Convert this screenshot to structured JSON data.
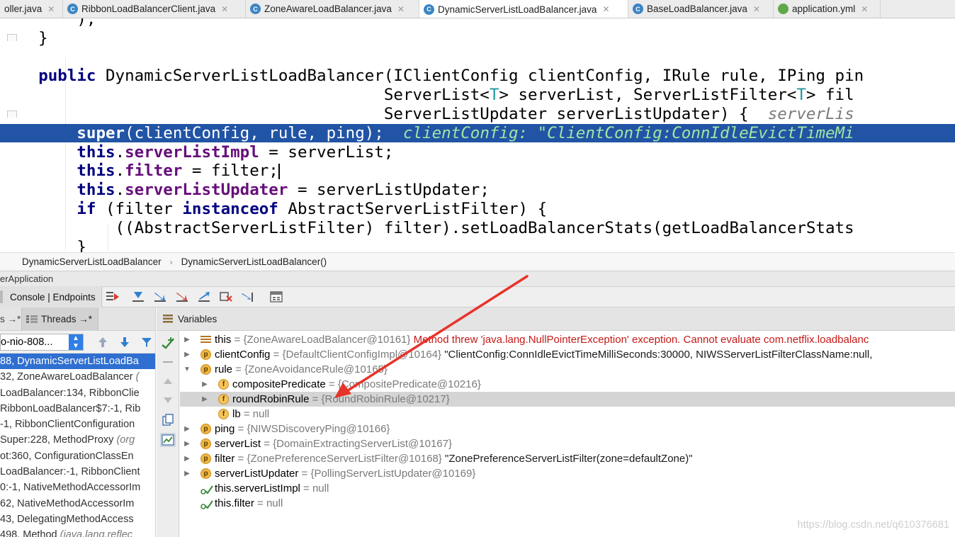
{
  "tabs": [
    {
      "label": "oller.java",
      "active": false,
      "icon": "",
      "close": "✕"
    },
    {
      "label": "RibbonLoadBalancerClient.java",
      "active": false,
      "icon": "java-class-icon",
      "close": "✕"
    },
    {
      "label": "ZoneAwareLoadBalancer.java",
      "active": false,
      "icon": "java-class-icon",
      "close": "✕"
    },
    {
      "label": "DynamicServerListLoadBalancer.java",
      "active": true,
      "icon": "java-class-icon",
      "close": "✕"
    },
    {
      "label": "BaseLoadBalancer.java",
      "active": false,
      "icon": "java-class-icon",
      "close": "✕"
    },
    {
      "label": "application.yml",
      "active": false,
      "icon": "yml-icon",
      "close": "✕"
    }
  ],
  "editor": {
    "lines": [
      {
        "segments": [
          {
            "t": "        );",
            "c": ""
          }
        ]
      },
      {
        "segments": [
          {
            "t": "    }",
            "c": ""
          }
        ]
      },
      {
        "segments": [
          {
            "t": "",
            "c": ""
          }
        ]
      },
      {
        "segments": [
          {
            "t": "    ",
            "c": ""
          },
          {
            "t": "public",
            "c": "kw"
          },
          {
            "t": " DynamicServerListLoadBalancer(IClientConfig clientConfig, IRule rule, IPing pin",
            "c": ""
          }
        ]
      },
      {
        "segments": [
          {
            "t": "                                        ServerList<",
            "c": ""
          },
          {
            "t": "T",
            "c": "gen"
          },
          {
            "t": "> serverList, ServerListFilter<",
            "c": ""
          },
          {
            "t": "T",
            "c": "gen"
          },
          {
            "t": "> fil",
            "c": ""
          }
        ]
      },
      {
        "segments": [
          {
            "t": "                                        ServerListUpdater serverListUpdater) {  ",
            "c": ""
          },
          {
            "t": "serverLis",
            "c": "hint"
          }
        ]
      },
      {
        "segments": [
          {
            "t": "        ",
            "c": ""
          },
          {
            "t": "super",
            "c": "kw"
          },
          {
            "t": "(clientConfig, rule, ping);  ",
            "c": ""
          },
          {
            "t": "clientConfig: \"ClientConfig:ConnIdleEvictTimeMi",
            "c": "hint-exec"
          }
        ],
        "exec": true
      },
      {
        "segments": [
          {
            "t": "        ",
            "c": ""
          },
          {
            "t": "this",
            "c": "kw"
          },
          {
            "t": ".",
            "c": ""
          },
          {
            "t": "serverListImpl",
            "c": "fld"
          },
          {
            "t": " = serverList;",
            "c": ""
          }
        ]
      },
      {
        "segments": [
          {
            "t": "        ",
            "c": ""
          },
          {
            "t": "this",
            "c": "kw"
          },
          {
            "t": ".",
            "c": ""
          },
          {
            "t": "filter",
            "c": "fld"
          },
          {
            "t": " = filter;",
            "c": ""
          }
        ],
        "caret": true
      },
      {
        "segments": [
          {
            "t": "        ",
            "c": ""
          },
          {
            "t": "this",
            "c": "kw"
          },
          {
            "t": ".",
            "c": ""
          },
          {
            "t": "serverListUpdater",
            "c": "fld"
          },
          {
            "t": " = serverListUpdater;",
            "c": ""
          }
        ]
      },
      {
        "segments": [
          {
            "t": "        ",
            "c": ""
          },
          {
            "t": "if",
            "c": "kw"
          },
          {
            "t": " (filter ",
            "c": ""
          },
          {
            "t": "instanceof",
            "c": "kw"
          },
          {
            "t": " AbstractServerListFilter) {",
            "c": ""
          }
        ]
      },
      {
        "segments": [
          {
            "t": "            ((AbstractServerListFilter) filter).setLoadBalancerStats(getLoadBalancerStats",
            "c": ""
          }
        ]
      },
      {
        "segments": [
          {
            "t": "        }",
            "c": ""
          }
        ]
      }
    ]
  },
  "breadcrumb": {
    "items": [
      "DynamicServerListLoadBalancer",
      "DynamicServerListLoadBalancer()"
    ],
    "sep": "›"
  },
  "debug": {
    "title": "erApplication",
    "toolbar_tab": "Console | Endpoints",
    "frames_tab": "s →*",
    "threads_tab": "Threads →*",
    "variables_tab": "Variables",
    "thread_select": "o-nio-808...",
    "frames": [
      {
        "loc": "88, DynamicServerListLoadBa",
        "cls": "",
        "sel": true
      },
      {
        "loc": "32, ZoneAwareLoadBalancer ",
        "cls": "(",
        "sel": false
      },
      {
        "loc": "LoadBalancer:134, RibbonClie",
        "cls": "",
        "sel": false
      },
      {
        "loc": "RibbonLoadBalancer$7:-1, Rib",
        "cls": "",
        "sel": false
      },
      {
        "loc": "-1, RibbonClientConfiguration",
        "cls": "",
        "sel": false
      },
      {
        "loc": "Super:228, MethodProxy ",
        "cls": "(org",
        "sel": false
      },
      {
        "loc": "ot:360, ConfigurationClassEn",
        "cls": "",
        "sel": false
      },
      {
        "loc": "LoadBalancer:-1, RibbonClient",
        "cls": "",
        "sel": false
      },
      {
        "loc": "0:-1, NativeMethodAccessorIm",
        "cls": "",
        "sel": false
      },
      {
        "loc": "62, NativeMethodAccessorIm",
        "cls": "",
        "sel": false
      },
      {
        "loc": "43, DelegatingMethodAccess",
        "cls": "",
        "sel": false
      },
      {
        "loc": "498, Method ",
        "cls": "(java.lang.reflec",
        "sel": false
      }
    ],
    "variables": [
      {
        "indent": 0,
        "tri": "▶",
        "icon": "lines",
        "name": "this",
        "ref": " = {ZoneAwareLoadBalancer@10161}",
        "err": " Method threw 'java.lang.NullPointerException' exception. Cannot evaluate com.netflix.loadbalanc",
        "str": ""
      },
      {
        "indent": 0,
        "tri": "▶",
        "icon": "p",
        "name": "clientConfig",
        "ref": " = {DefaultClientConfigImpl@10164}",
        "err": "",
        "str": " \"ClientConfig:ConnIdleEvictTimeMilliSeconds:30000, NIWSServerListFilterClassName:null,"
      },
      {
        "indent": 0,
        "tri": "▼",
        "icon": "p",
        "name": "rule",
        "ref": " = {ZoneAvoidanceRule@10165}",
        "err": "",
        "str": ""
      },
      {
        "indent": 1,
        "tri": "▶",
        "icon": "f",
        "name": "compositePredicate",
        "ref": " = {CompositePredicate@10216}",
        "err": "",
        "str": ""
      },
      {
        "indent": 1,
        "tri": "▶",
        "icon": "f",
        "name": "roundRobinRule",
        "ref": " = {RoundRobinRule@10217}",
        "err": "",
        "str": "",
        "hl": true
      },
      {
        "indent": 1,
        "tri": "",
        "icon": "f",
        "name": "lb",
        "ref": " = null",
        "err": "",
        "str": ""
      },
      {
        "indent": 0,
        "tri": "▶",
        "icon": "p",
        "name": "ping",
        "ref": " = {NIWSDiscoveryPing@10166}",
        "err": "",
        "str": ""
      },
      {
        "indent": 0,
        "tri": "▶",
        "icon": "p",
        "name": "serverList",
        "ref": " = {DomainExtractingServerList@10167}",
        "err": "",
        "str": ""
      },
      {
        "indent": 0,
        "tri": "▶",
        "icon": "p",
        "name": "filter",
        "ref": " = {ZonePreferenceServerListFilter@10168}",
        "err": "",
        "str": " \"ZonePreferenceServerListFilter(zone=defaultZone)\""
      },
      {
        "indent": 0,
        "tri": "▶",
        "icon": "p",
        "name": "serverListUpdater",
        "ref": " = {PollingServerListUpdater@10169}",
        "err": "",
        "str": ""
      },
      {
        "indent": 0,
        "tri": "",
        "icon": "watch",
        "name": "this.serverListImpl",
        "ref": " = null",
        "err": "",
        "str": ""
      },
      {
        "indent": 0,
        "tri": "",
        "icon": "watch",
        "name": "this.filter",
        "ref": " = null",
        "err": "",
        "str": ""
      }
    ]
  },
  "watermark": "https://blog.csdn.net/q610376681",
  "colors": {
    "exec_line": "#2154a5",
    "keyword": "#000080",
    "field": "#660e7a",
    "selected_frame": "#2f6fd1",
    "error_text": "#c41a16",
    "annotation_arrow": "#e8332a"
  }
}
